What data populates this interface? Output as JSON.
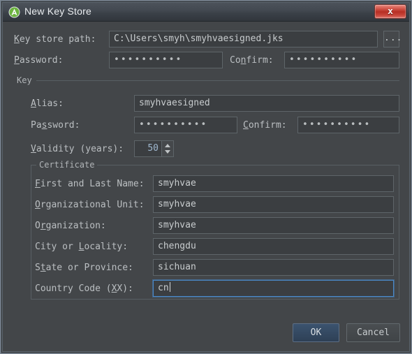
{
  "window": {
    "title": "New Key Store",
    "icon": "android-studio-icon",
    "close_label": "x",
    "accent_focus": "#4a88c7",
    "bg": "#434649",
    "titlebar_bg": "#3a4047"
  },
  "keystore": {
    "path_label_pre": "",
    "path_label_mnemonic": "K",
    "path_label_post": "ey store path:",
    "path_value": "C:\\Users\\smyh\\smyhvaesigned.jks",
    "browse_label": "...",
    "password_label_mnemonic": "P",
    "password_label_post": "assword:",
    "password_value": "••••••••••",
    "confirm_label_pre": "Co",
    "confirm_label_mnemonic": "n",
    "confirm_label_post": "firm:",
    "confirm_value": "••••••••••"
  },
  "key": {
    "group_label": "Key",
    "alias_label_mnemonic": "A",
    "alias_label_post": "lias:",
    "alias_value": "smyhvaesigned",
    "password_label_pre": "Pa",
    "password_label_mnemonic": "s",
    "password_label_post": "sword:",
    "password_value": "••••••••••",
    "confirm_label_mnemonic": "C",
    "confirm_label_post": "onfirm:",
    "confirm_value": "••••••••••",
    "validity_label_mnemonic": "V",
    "validity_label_post": "alidity (years):",
    "validity_value": "50"
  },
  "certificate": {
    "group_label": "Certificate",
    "fields": [
      {
        "label_pre": "",
        "label_mnemonic": "F",
        "label_post": "irst and Last Name:",
        "value": "smyhvae",
        "focused": false
      },
      {
        "label_pre": "",
        "label_mnemonic": "O",
        "label_post": "rganizational Unit:",
        "value": "smyhvae",
        "focused": false
      },
      {
        "label_pre": "O",
        "label_mnemonic": "r",
        "label_post": "ganization:",
        "value": "smyhvae",
        "focused": false
      },
      {
        "label_pre": "City or ",
        "label_mnemonic": "L",
        "label_post": "ocality:",
        "value": "chengdu",
        "focused": false
      },
      {
        "label_pre": "S",
        "label_mnemonic": "t",
        "label_post": "ate or Province:",
        "value": "sichuan",
        "focused": false
      },
      {
        "label_pre": "Country Code (",
        "label_mnemonic": "X",
        "label_post": "X):",
        "value": "cn",
        "focused": true
      }
    ]
  },
  "buttons": {
    "ok": "OK",
    "cancel": "Cancel"
  }
}
